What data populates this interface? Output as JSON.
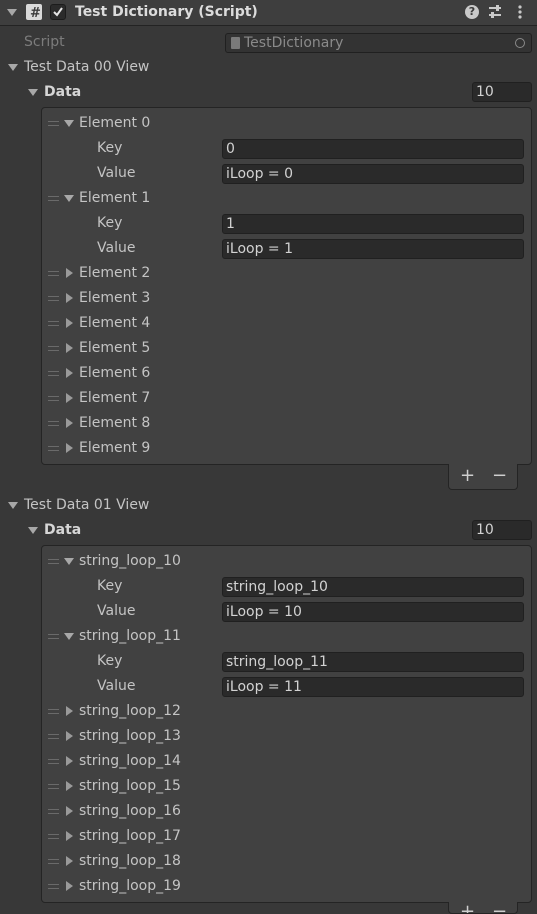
{
  "header": {
    "title": "Test Dictionary (Script)",
    "enabled": true
  },
  "script_row": {
    "label": "Script",
    "value": "TestDictionary"
  },
  "sections": [
    {
      "title": "Test Data 00 View",
      "data_label": "Data",
      "size": "10",
      "expanded": [
        {
          "label": "Element 0",
          "key_label": "Key",
          "key": "0",
          "value_label": "Value",
          "value": "iLoop = 0"
        },
        {
          "label": "Element 1",
          "key_label": "Key",
          "key": "1",
          "value_label": "Value",
          "value": "iLoop = 1"
        }
      ],
      "collapsed": [
        "Element 2",
        "Element 3",
        "Element 4",
        "Element 5",
        "Element 6",
        "Element 7",
        "Element 8",
        "Element 9"
      ]
    },
    {
      "title": "Test Data 01 View",
      "data_label": "Data",
      "size": "10",
      "expanded": [
        {
          "label": "string_loop_10",
          "key_label": "Key",
          "key": "string_loop_10",
          "value_label": "Value",
          "value": "iLoop = 10"
        },
        {
          "label": "string_loop_11",
          "key_label": "Key",
          "key": "string_loop_11",
          "value_label": "Value",
          "value": "iLoop = 11"
        }
      ],
      "collapsed": [
        "string_loop_12",
        "string_loop_13",
        "string_loop_14",
        "string_loop_15",
        "string_loop_16",
        "string_loop_17",
        "string_loop_18",
        "string_loop_19"
      ]
    }
  ],
  "footer": {
    "add": "+",
    "remove": "−"
  }
}
